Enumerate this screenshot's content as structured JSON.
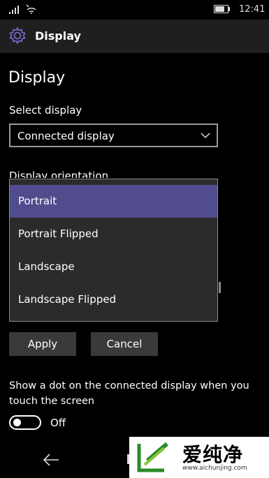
{
  "status_bar": {
    "time": "12:41",
    "icons": [
      "signal-icon",
      "wifi-icon",
      "battery-icon"
    ]
  },
  "header": {
    "icon": "gear-icon",
    "title": "Display"
  },
  "page": {
    "title": "Display",
    "select_display_label": "Select display",
    "select_display_value": "Connected display",
    "orientation_label": "Display orientation"
  },
  "orientation_dropdown": {
    "options": [
      "Portrait",
      "Portrait Flipped",
      "Landscape",
      "Landscape Flipped"
    ],
    "selected": "Portrait"
  },
  "buttons": {
    "apply": "Apply",
    "cancel": "Cancel"
  },
  "dot_setting": {
    "description": "Show a dot on the connected display when you touch the screen",
    "toggle_state": "Off"
  },
  "watermark": {
    "brand_text": "爱纯净",
    "url": "www.aichunjing.com"
  },
  "colors": {
    "accent": "#514c8d",
    "background": "#000000",
    "header": "#1f1f1f",
    "button": "#3a3a3a"
  }
}
